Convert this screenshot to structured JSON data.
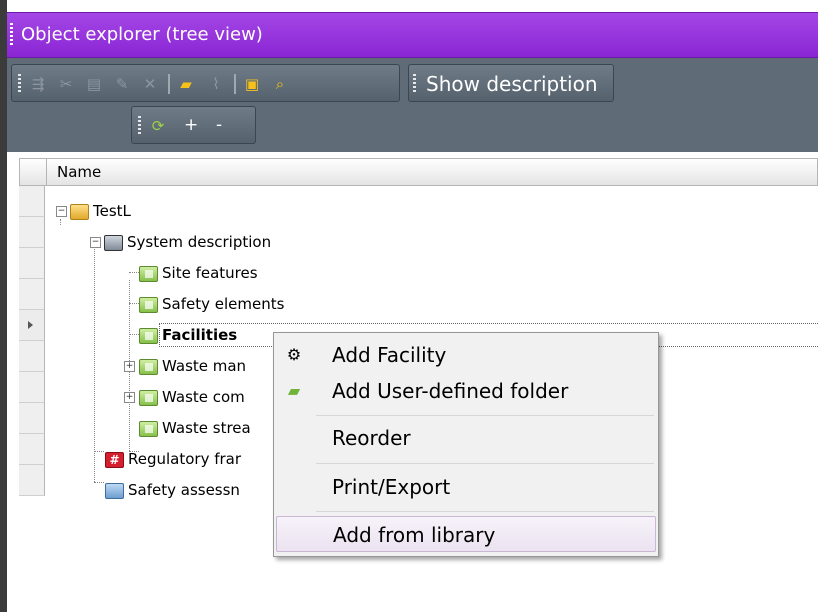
{
  "window": {
    "title": "Object explorer (tree view)"
  },
  "toolbar": {
    "icons": [
      "move-icon",
      "cut-icon",
      "paste-icon",
      "rename-icon",
      "delete-icon",
      "new-folder-icon",
      "attach-icon",
      "properties-icon",
      "search-icon"
    ],
    "show_description": "Show description",
    "secondary": {
      "refresh_icon": "refresh-icon",
      "expand": "+",
      "collapse": "-"
    }
  },
  "grid": {
    "columns": [
      "Name"
    ],
    "tree": [
      {
        "label": "TestL",
        "icon": "folder-icon",
        "level": 0,
        "expanded": true
      },
      {
        "label": "System description",
        "icon": "house-icon",
        "level": 1,
        "expanded": true
      },
      {
        "label": "Site features",
        "icon": "green-folder-icon",
        "level": 2
      },
      {
        "label": "Safety elements",
        "icon": "green-folder-icon",
        "level": 2
      },
      {
        "label": "Facilities",
        "icon": "green-folder-icon",
        "level": 2,
        "selected": true
      },
      {
        "label": "Waste man",
        "icon": "green-folder-icon",
        "level": 2,
        "expanded": false
      },
      {
        "label": "Waste com",
        "icon": "green-folder-icon",
        "level": 2,
        "expanded": false
      },
      {
        "label": "Waste strea",
        "icon": "green-folder-icon",
        "level": 2
      },
      {
        "label": "Regulatory frar",
        "icon": "hash-icon",
        "level": 1
      },
      {
        "label": "Safety assessn",
        "icon": "blue-folder-icon",
        "level": 1
      }
    ]
  },
  "context_menu": {
    "items": [
      {
        "label": "Add Facility",
        "icon": "facility-icon"
      },
      {
        "label": "Add User-defined folder",
        "icon": "green-folder-icon"
      },
      {
        "label": "Reorder"
      },
      {
        "label": "Print/Export"
      },
      {
        "label": "Add from library",
        "hover": true
      }
    ]
  },
  "colors": {
    "title_bar": "#9b3ae0",
    "toolbar_bg": "#5f6b77",
    "menu_hover": "#ebe3f0"
  }
}
